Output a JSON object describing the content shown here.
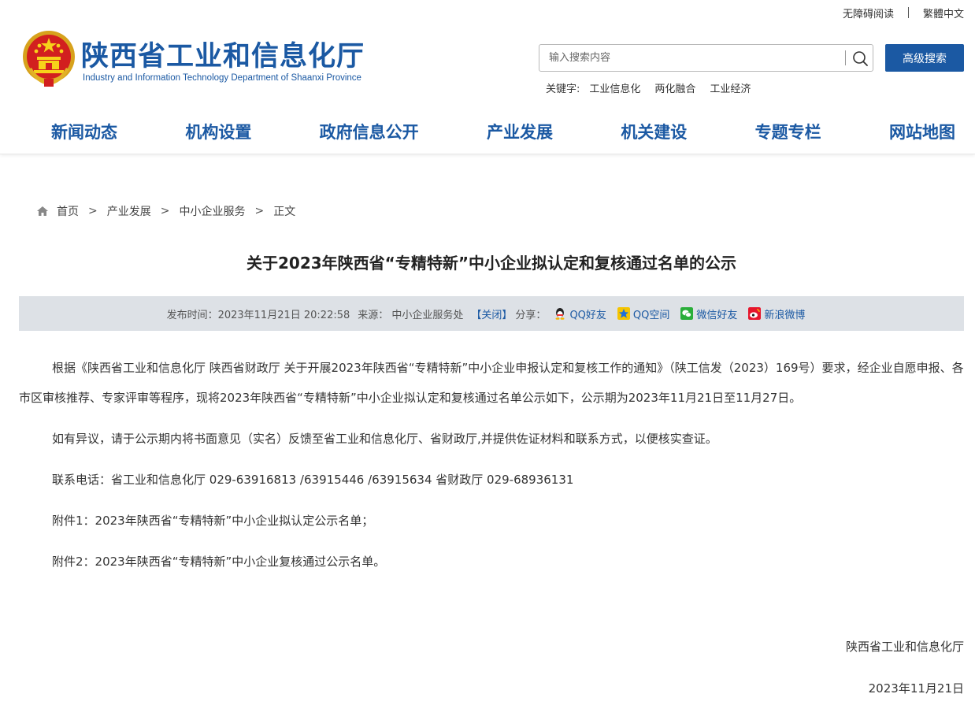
{
  "topbar": {
    "accessibility": "无障碍阅读",
    "traditional": "繁體中文"
  },
  "header": {
    "site_title": "陕西省工业和信息化厅",
    "site_subtitle": "Industry and Information Technology Department of Shaanxi Province",
    "search_placeholder": "输入搜索内容",
    "advanced_search": "高级搜索",
    "keywords_label": "关键字:",
    "keywords": [
      "工业信息化",
      "两化融合",
      "工业经济"
    ]
  },
  "nav": [
    "新闻动态",
    "机构设置",
    "政府信息公开",
    "产业发展",
    "机关建设",
    "专题专栏",
    "网站地图"
  ],
  "breadcrumb": [
    "首页",
    "产业发展",
    "中小企业服务",
    "正文"
  ],
  "article": {
    "title": "关于2023年陕西省“专精特新”中小企业拟认定和复核通过名单的公示",
    "meta": {
      "publish_time": "发布时间：2023年11月21日 20:22:58",
      "source": "来源：  中小企业服务处",
      "close": "【关闭】",
      "share_label": "分享：",
      "share": [
        "QQ好友",
        "QQ空间",
        "微信好友",
        "新浪微博"
      ]
    },
    "paragraphs": [
      "根据《陕西省工业和信息化厅 陕西省财政厅 关于开展2023年陕西省“专精特新”中小企业申报认定和复核工作的通知》（陕工信发（2023）169号）要求，经企业自愿申报、各市区审核推荐、专家评审等程序，现将2023年陕西省“专精特新”中小企业拟认定和复核通过名单公示如下，公示期为2023年11月21日至11月27日。",
      "如有异议，请于公示期内将书面意见（实名）反馈至省工业和信息化厅、省财政厅,并提供佐证材料和联系方式，以便核实查证。",
      "联系电话：省工业和信息化厅  029-63916813 /63915446 /63915634   省财政厅  029-68936131",
      "附件1：2023年陕西省“专精特新”中小企业拟认定公示名单；",
      "附件2：2023年陕西省“专精特新”中小企业复核通过公示名单。"
    ],
    "signature_org": "陕西省工业和信息化厅",
    "signature_date": "2023年11月21日"
  },
  "colors": {
    "brand_blue": "#1b59a3",
    "meta_bg": "#dde1e6"
  },
  "icons": [
    "national-emblem-icon",
    "search-icon",
    "home-icon",
    "qq-icon",
    "qzone-icon",
    "wechat-icon",
    "weibo-icon"
  ]
}
